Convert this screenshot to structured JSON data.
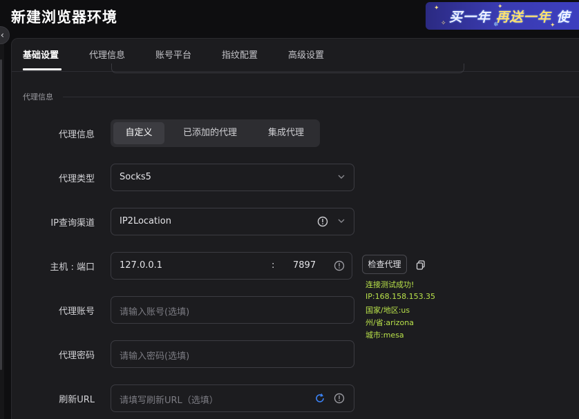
{
  "window": {
    "title": "新建浏览器环境"
  },
  "promo": {
    "text_part1": "买一年",
    "text_part2": "再送一年",
    "text_part3": "使"
  },
  "tabs": [
    {
      "label": "基础设置",
      "active": true
    },
    {
      "label": "代理信息",
      "active": false
    },
    {
      "label": "账号平台",
      "active": false
    },
    {
      "label": "指纹配置",
      "active": false
    },
    {
      "label": "高级设置",
      "active": false
    }
  ],
  "section": {
    "title": "代理信息"
  },
  "form": {
    "proxy_info": {
      "label": "代理信息",
      "options": [
        "自定义",
        "已添加的代理",
        "集成代理"
      ],
      "selected": "自定义"
    },
    "proxy_type": {
      "label": "代理类型",
      "value": "Socks5"
    },
    "ip_channel": {
      "label": "IP查询渠道",
      "value": "IP2Location"
    },
    "host_port": {
      "label": "主机 : 端口",
      "host": "127.0.0.1",
      "separator": ":",
      "port": "7897",
      "check_button": "检查代理"
    },
    "proxy_account": {
      "label": "代理账号",
      "placeholder": "请输入账号(选填)"
    },
    "proxy_password": {
      "label": "代理密码",
      "placeholder": "请输入密码(选填)"
    },
    "refresh_url": {
      "label": "刷新URL",
      "placeholder": "请填写刷新URL（选填）"
    }
  },
  "check_result": {
    "status": "连接测试成功!",
    "ip": "IP:168.158.153.35",
    "country": "国家/地区:us",
    "state": "州/省:arizona",
    "city": "城市:mesa"
  },
  "colors": {
    "background": "#0e0e10",
    "panel": "#1c1c1f",
    "success_text": "#b9e24a",
    "refresh_icon": "#3b82f6"
  }
}
